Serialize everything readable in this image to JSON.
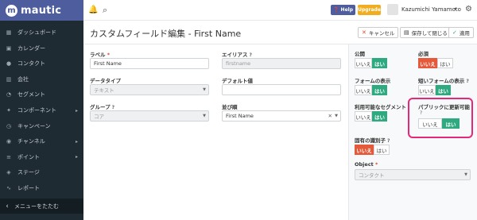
{
  "app": {
    "brand": "mautic",
    "logo_letter": "m"
  },
  "sidebar": {
    "items": [
      {
        "icon": "dashboard-icon",
        "glyph": "▦",
        "label": "ダッシュボード",
        "has_arrow": false
      },
      {
        "icon": "calendar-icon",
        "glyph": "▣",
        "label": "カレンダー",
        "has_arrow": false
      },
      {
        "icon": "user-icon",
        "glyph": "●",
        "label": "コンタクト",
        "has_arrow": false
      },
      {
        "icon": "building-icon",
        "glyph": "▥",
        "label": "会社",
        "has_arrow": false
      },
      {
        "icon": "pie-chart-icon",
        "glyph": "◔",
        "label": "セグメント",
        "has_arrow": false
      },
      {
        "icon": "puzzle-icon",
        "glyph": "✦",
        "label": "コンポーネント",
        "has_arrow": true
      },
      {
        "icon": "clock-icon",
        "glyph": "◷",
        "label": "キャンペーン",
        "has_arrow": false
      },
      {
        "icon": "rss-icon",
        "glyph": "◉",
        "label": "チャンネル",
        "has_arrow": true
      },
      {
        "icon": "sliders-icon",
        "glyph": "≡",
        "label": "ポイント",
        "has_arrow": true
      },
      {
        "icon": "cube-icon",
        "glyph": "◈",
        "label": "ステージ",
        "has_arrow": false
      },
      {
        "icon": "line-chart-icon",
        "glyph": "∿",
        "label": "レポート",
        "has_arrow": false
      }
    ],
    "collapse_label": "メニューをたたむ",
    "collapse_glyph": "‹"
  },
  "topbar": {
    "help_label": "❓ Help",
    "upgrade_label": "Upgrade",
    "username": "Kazumichi Yamamoto",
    "caret": "▾",
    "bell": "🔔",
    "search": "⌕",
    "gear": "⚙"
  },
  "header": {
    "title": "カスタムフィールド編集 - First Name",
    "cancel_label": "キャンセル",
    "cancel_glyph": "✕",
    "save_close_label": "保存して閉じる",
    "save_close_glyph": "▤",
    "apply_label": "適用",
    "apply_glyph": "✓"
  },
  "form": {
    "label_label": "ラベル",
    "label_value": "First Name",
    "alias_label": "エイリアス",
    "alias_value": "firstname",
    "datatype_label": "データタイプ",
    "datatype_value": "テキスト",
    "default_label": "デフォルト値",
    "default_value": "",
    "group_label": "グループ",
    "group_value": "コア",
    "order_label": "並び順",
    "order_value": "First Name",
    "required_mark": "*",
    "help_glyph": "?",
    "clear_glyph": "✕",
    "dd_glyph": "▼"
  },
  "side": {
    "no": "いいえ",
    "yes": "はい",
    "public_label": "公開",
    "required_label": "必須",
    "form_display_label": "フォームの表示",
    "short_form_label": "短いフォームの表示",
    "segment_label": "利用可能なセグメント",
    "public_update_label": "パブリックに更新可能",
    "unique_label": "固有の識別子",
    "object_label": "Object",
    "object_value": "コンタクト"
  },
  "colors": {
    "accent": "#4e5d9d",
    "yes_green": "#2fa97f",
    "red": "#e55a3a",
    "highlight": "#e6287a"
  }
}
